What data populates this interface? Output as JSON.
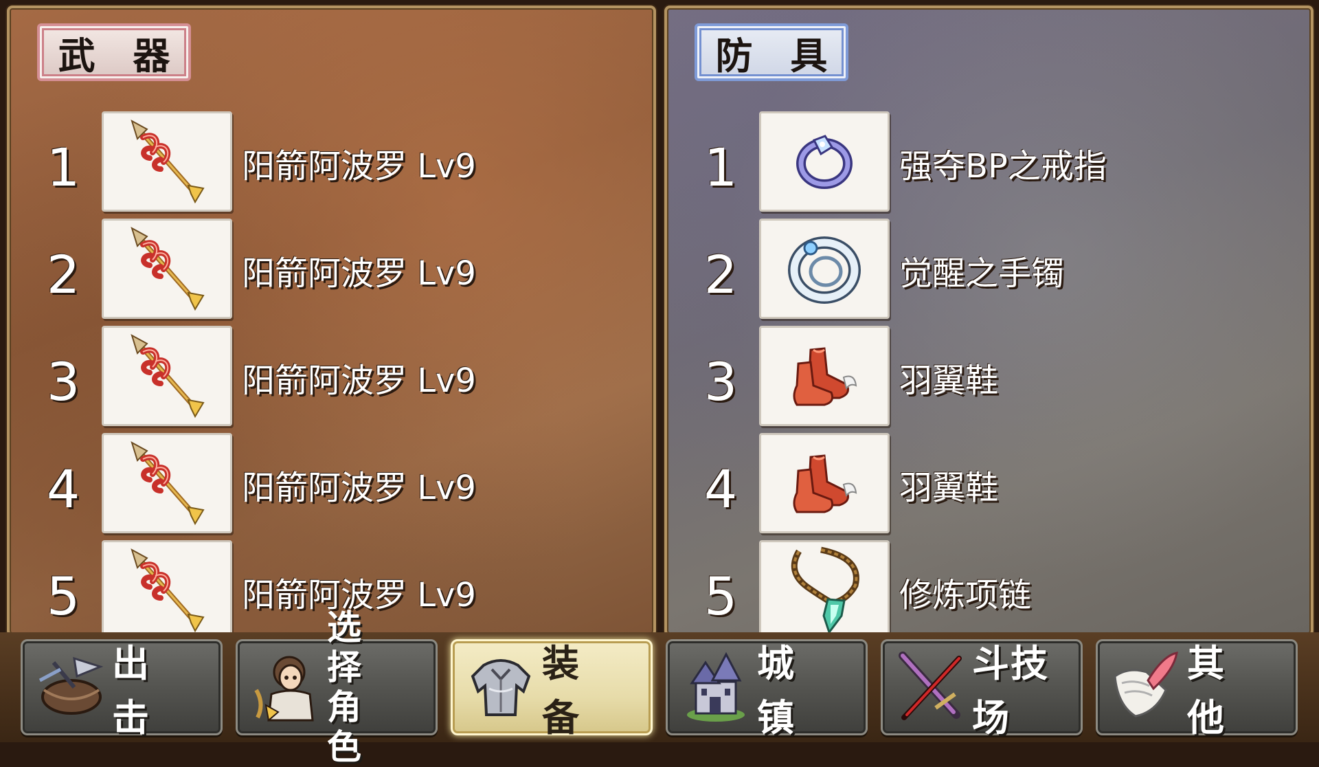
{
  "weapon_panel": {
    "title": "武 器",
    "items": [
      {
        "num": "1",
        "name": "阳箭阿波罗 Lv9",
        "icon": "fire-arrow-icon"
      },
      {
        "num": "2",
        "name": "阳箭阿波罗 Lv9",
        "icon": "fire-arrow-icon"
      },
      {
        "num": "3",
        "name": "阳箭阿波罗 Lv9",
        "icon": "fire-arrow-icon"
      },
      {
        "num": "4",
        "name": "阳箭阿波罗 Lv9",
        "icon": "fire-arrow-icon"
      },
      {
        "num": "5",
        "name": "阳箭阿波罗 Lv9",
        "icon": "fire-arrow-icon"
      }
    ]
  },
  "armor_panel": {
    "title": "防 具",
    "items": [
      {
        "num": "1",
        "name": "强夺BP之戒指",
        "icon": "ring-icon"
      },
      {
        "num": "2",
        "name": "觉醒之手镯",
        "icon": "bracelet-icon"
      },
      {
        "num": "3",
        "name": "羽翼鞋",
        "icon": "winged-boots-icon"
      },
      {
        "num": "4",
        "name": "羽翼鞋",
        "icon": "winged-boots-icon"
      },
      {
        "num": "5",
        "name": "修炼项链",
        "icon": "necklace-icon"
      }
    ]
  },
  "nav": {
    "sortie": "出 击",
    "select_line1": "选 择",
    "select_line2": "角 色",
    "equip": "装 备",
    "town": "城 镇",
    "arena": "斗技场",
    "other": "其 他",
    "active": "equip"
  }
}
